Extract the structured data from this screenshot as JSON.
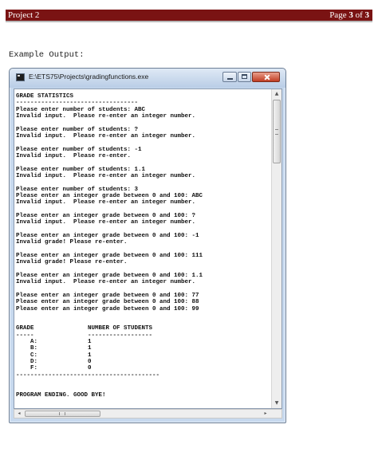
{
  "document_header": {
    "left_text": "Project 2",
    "page_prefix": "Page ",
    "page_number": "3",
    "page_of": " of ",
    "page_total": "3",
    "bar_color": "#7a1313"
  },
  "example_label": "Example Output:",
  "window": {
    "title": "E:\\ETS75\\Projects\\gradingfunctions.exe",
    "icon": "console-app-icon",
    "buttons": [
      "minimize-icon",
      "maximize-icon",
      "close-icon"
    ]
  },
  "console": {
    "lines": [
      "GRADE STATISTICS",
      "----------------------------------",
      "Please enter number of students: ABC",
      "Invalid input.  Please re-enter an integer number.",
      "",
      "Please enter number of students: ?",
      "Invalid input.  Please re-enter an integer number.",
      "",
      "Please enter number of students: -1",
      "Invalid input.  Please re-enter.",
      "",
      "Please enter number of students: 1.1",
      "Invalid input.  Please re-enter an integer number.",
      "",
      "Please enter number of students: 3",
      "Please enter an integer grade between 0 and 100: ABC",
      "Invalid input.  Please re-enter an integer number.",
      "",
      "Please enter an integer grade between 0 and 100: ?",
      "Invalid input.  Please re-enter an integer number.",
      "",
      "Please enter an integer grade between 0 and 100: -1",
      "Invalid grade! Please re-enter.",
      "",
      "Please enter an integer grade between 0 and 100: 111",
      "Invalid grade! Please re-enter.",
      "",
      "Please enter an integer grade between 0 and 100: 1.1",
      "Invalid input.  Please re-enter an integer number.",
      "",
      "Please enter an integer grade between 0 and 100: 77",
      "Please enter an integer grade between 0 and 100: 88",
      "Please enter an integer grade between 0 and 100: 99",
      "",
      "",
      "GRADE               NUMBER OF STUDENTS",
      "-----               ------------------",
      "    A:              1",
      "    B:              1",
      "    C:              1",
      "    D:              0",
      "    F:              0",
      "----------------------------------------",
      "",
      "",
      "PROGRAM ENDING. GOOD BYE!"
    ]
  },
  "scroll_arrows": {
    "up": "▲",
    "down": "▼",
    "left": "◂",
    "right": "▸"
  }
}
